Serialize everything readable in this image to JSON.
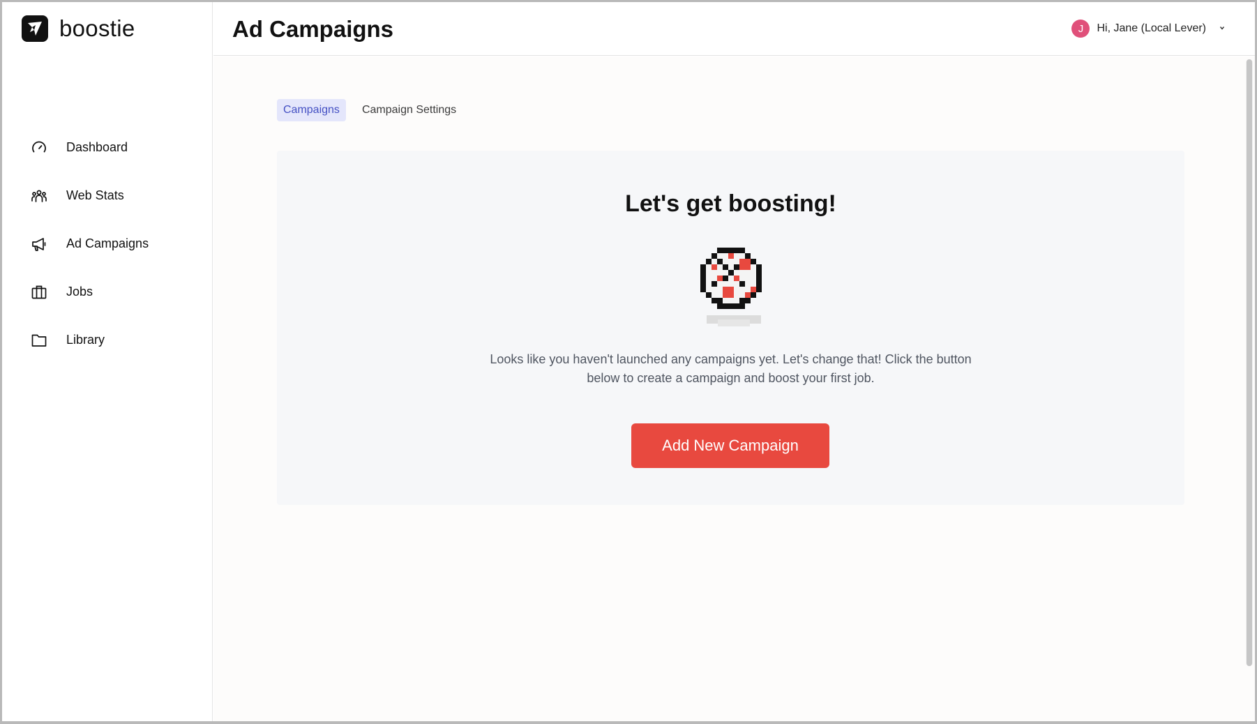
{
  "brand": {
    "name": "boostie"
  },
  "sidebar": {
    "items": [
      {
        "label": "Dashboard",
        "icon": "gauge-icon"
      },
      {
        "label": "Web Stats",
        "icon": "users-icon"
      },
      {
        "label": "Ad Campaigns",
        "icon": "megaphone-icon"
      },
      {
        "label": "Jobs",
        "icon": "briefcase-icon"
      },
      {
        "label": "Library",
        "icon": "folder-icon"
      }
    ]
  },
  "header": {
    "title": "Ad Campaigns",
    "user": {
      "avatar_initial": "J",
      "greeting": "Hi, Jane (Local Lever)",
      "avatar_color": "#e0507a"
    }
  },
  "tabs": [
    {
      "label": "Campaigns",
      "active": true
    },
    {
      "label": "Campaign Settings",
      "active": false
    }
  ],
  "empty_state": {
    "title": "Let's get boosting!",
    "text": "Looks like you haven't launched any campaigns yet. Let's change that! Click the button below to create a campaign and boost your first job.",
    "button_label": "Add New Campaign",
    "illustration": "pixel-dartboard-icon"
  },
  "colors": {
    "accent": "#e8493f",
    "tab_active_bg": "#e4e6fb",
    "tab_active_text": "#4450c3"
  }
}
